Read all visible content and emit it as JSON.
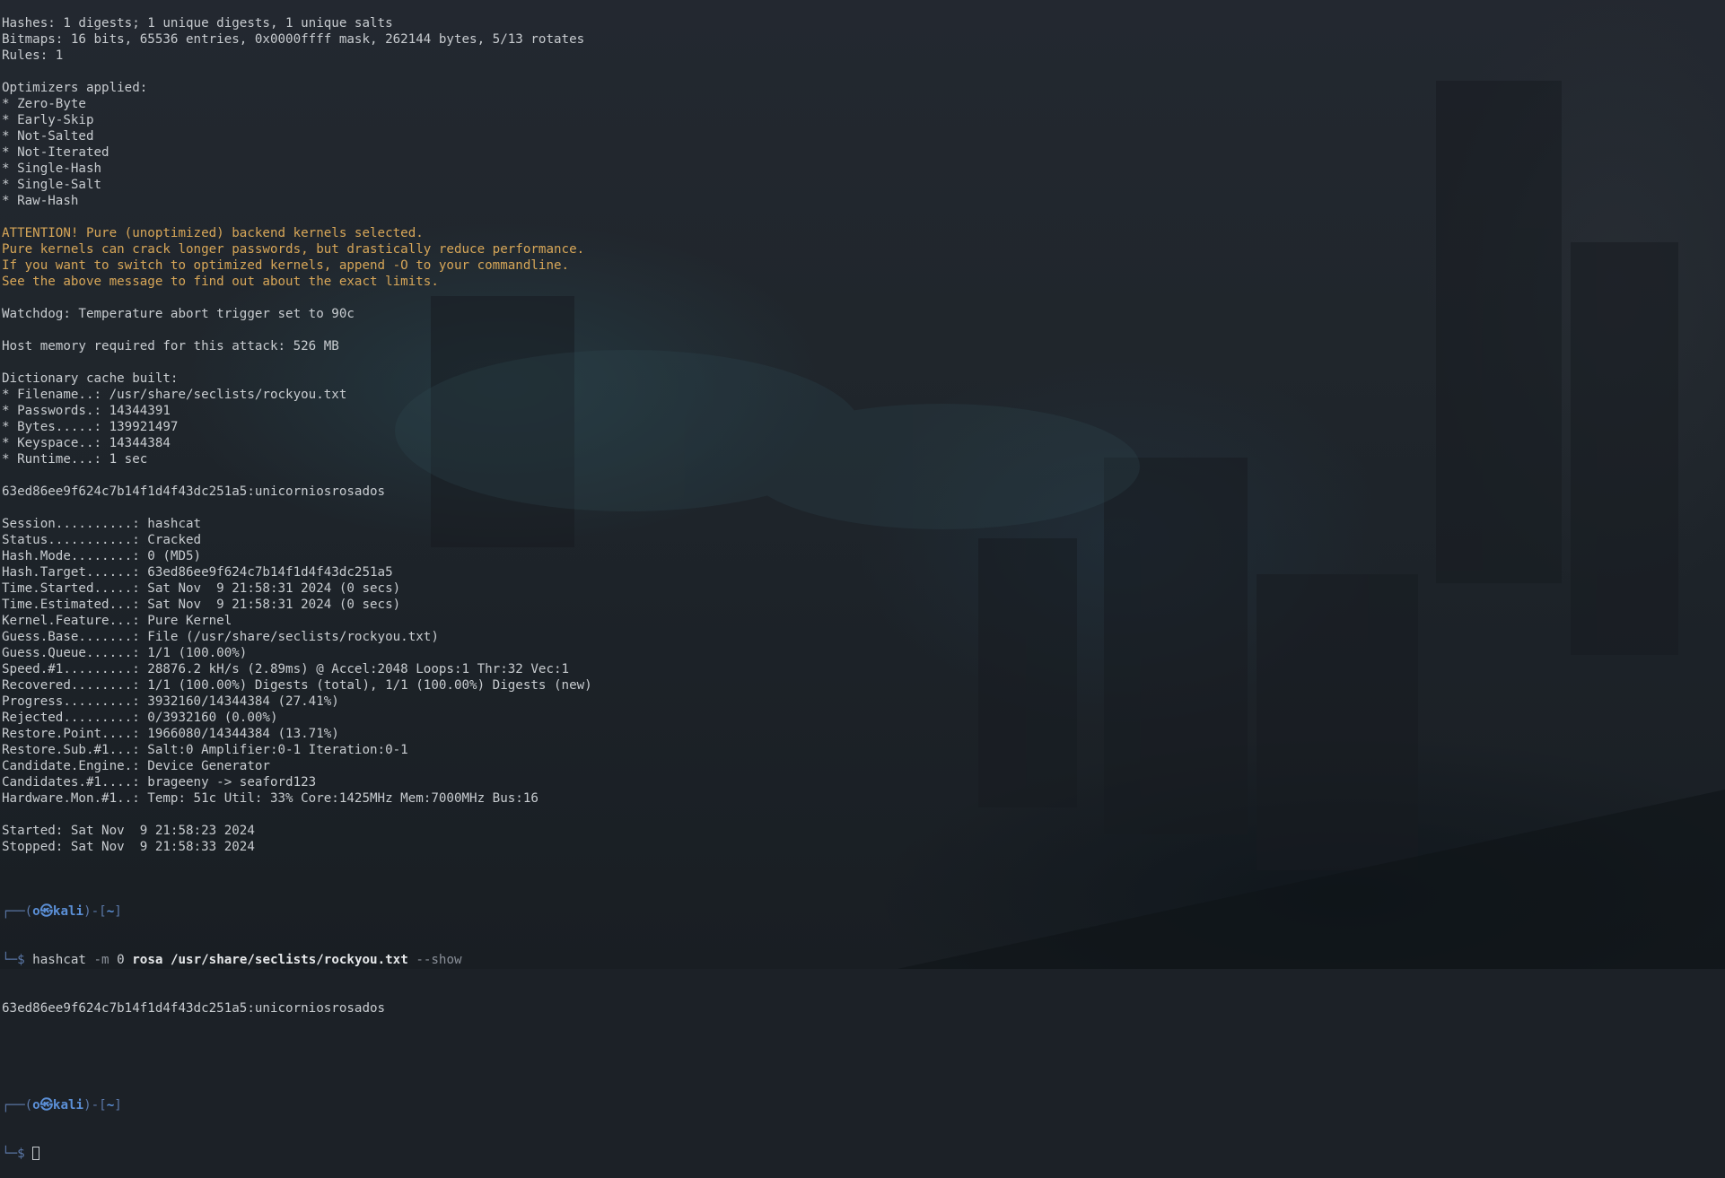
{
  "terminal": {
    "block1": [
      "Hashes: 1 digests; 1 unique digests, 1 unique salts",
      "Bitmaps: 16 bits, 65536 entries, 0x0000ffff mask, 262144 bytes, 5/13 rotates",
      "Rules: 1",
      "",
      "Optimizers applied:",
      "* Zero-Byte",
      "* Early-Skip",
      "* Not-Salted",
      "* Not-Iterated",
      "* Single-Hash",
      "* Single-Salt",
      "* Raw-Hash",
      ""
    ],
    "warning": [
      "ATTENTION! Pure (unoptimized) backend kernels selected.",
      "Pure kernels can crack longer passwords, but drastically reduce performance.",
      "If you want to switch to optimized kernels, append -O to your commandline.",
      "See the above message to find out about the exact limits."
    ],
    "block2": [
      "",
      "Watchdog: Temperature abort trigger set to 90c",
      "",
      "Host memory required for this attack: 526 MB",
      "",
      "Dictionary cache built:",
      "* Filename..: /usr/share/seclists/rockyou.txt",
      "* Passwords.: 14344391",
      "* Bytes.....: 139921497",
      "* Keyspace..: 14344384",
      "* Runtime...: 1 sec",
      "",
      "63ed86ee9f624c7b14f1d4f43dc251a5:unicorniosrosados",
      "",
      "Session..........: hashcat",
      "Status...........: Cracked",
      "Hash.Mode........: 0 (MD5)",
      "Hash.Target......: 63ed86ee9f624c7b14f1d4f43dc251a5",
      "Time.Started.....: Sat Nov  9 21:58:31 2024 (0 secs)",
      "Time.Estimated...: Sat Nov  9 21:58:31 2024 (0 secs)",
      "Kernel.Feature...: Pure Kernel",
      "Guess.Base.......: File (/usr/share/seclists/rockyou.txt)",
      "Guess.Queue......: 1/1 (100.00%)",
      "Speed.#1.........: 28876.2 kH/s (2.89ms) @ Accel:2048 Loops:1 Thr:32 Vec:1",
      "Recovered........: 1/1 (100.00%) Digests (total), 1/1 (100.00%) Digests (new)",
      "Progress.........: 3932160/14344384 (27.41%)",
      "Rejected.........: 0/3932160 (0.00%)",
      "Restore.Point....: 1966080/14344384 (13.71%)",
      "Restore.Sub.#1...: Salt:0 Amplifier:0-1 Iteration:0-1",
      "Candidate.Engine.: Device Generator",
      "Candidates.#1....: brageeny -> seaford123",
      "Hardware.Mon.#1..: Temp: 51c Util: 33% Core:1425MHz Mem:7000MHz Bus:16",
      "",
      "Started: Sat Nov  9 21:58:23 2024",
      "Stopped: Sat Nov  9 21:58:33 2024",
      ""
    ],
    "prompt1": {
      "deco_top_left": "┌──(",
      "user_host": "o㉿kali",
      "deco_top_mid": ")-[",
      "cwd": "~",
      "deco_top_right": "]",
      "deco_bottom": "└─$ ",
      "cmd": "hashcat",
      "flag_m": "-m",
      "mode": "0",
      "hash_file": "rosa",
      "wordlist": "/usr/share/seclists/rockyou.txt",
      "flag_show": "--show"
    },
    "show_output": "63ed86ee9f624c7b14f1d4f43dc251a5:unicorniosrosados",
    "prompt2": {
      "deco_top_left": "┌──(",
      "user_host": "o㉿kali",
      "deco_top_mid": ")-[",
      "cwd": "~",
      "deco_top_right": "]",
      "deco_bottom": "└─$ "
    }
  },
  "colors": {
    "text": "#c8ccd0",
    "warning": "#d7a658",
    "prompt_deco": "#5b78a8",
    "prompt_user": "#5b8fd6"
  }
}
